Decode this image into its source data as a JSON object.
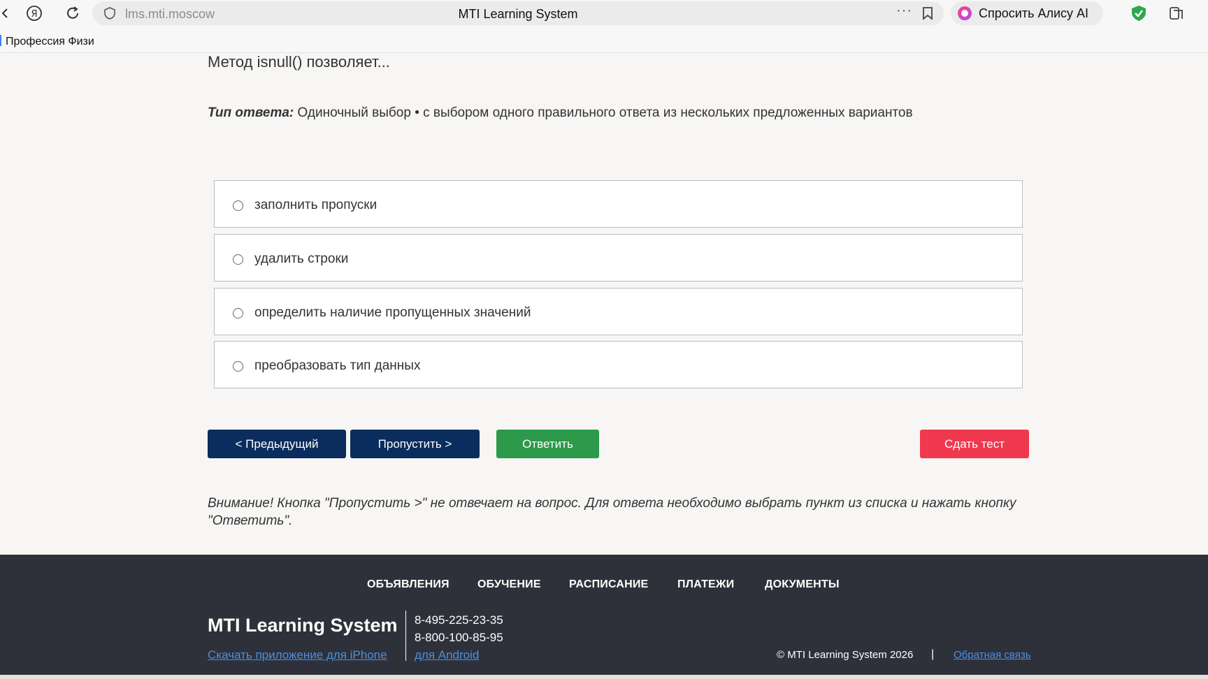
{
  "browser": {
    "url": "lms.mti.moscow",
    "tab_title": "MTI Learning System",
    "alice_label": "Спросить Алису AI",
    "bookmark_item": "Профессия Физи"
  },
  "question": {
    "text": "Метод isnull() позволяет...",
    "answer_type_label": "Тип ответа:",
    "answer_type_value": " Одиночный выбор • с выбором одного правильного ответа из нескольких предложенных вариантов"
  },
  "options": [
    {
      "label": "заполнить пропуски"
    },
    {
      "label": "удалить строки"
    },
    {
      "label": "определить наличие пропущенных значений"
    },
    {
      "label": "преобразовать тип данных"
    }
  ],
  "buttons": {
    "prev": "< Предыдущий",
    "skip": "Пропустить >",
    "answer": "Ответить",
    "submit": "Сдать тест"
  },
  "warning": "Внимание! Кнопка \"Пропустить >\" не отвечает на вопрос. Для ответа необходимо выбрать пункт из списка и нажать кнопку \"Ответить\".",
  "footer": {
    "nav": [
      "ОБЪЯВЛЕНИЯ",
      "ОБУЧЕНИЕ",
      "РАСПИСАНИЕ",
      "ПЛАТЕЖИ",
      "ДОКУМЕНТЫ"
    ],
    "brand": "MTI Learning System",
    "phones": [
      "8-495-225-23-35",
      "8-800-100-85-95"
    ],
    "iphone_link": "Скачать приложение для iPhone",
    "android_link": "для Android",
    "copyright": "© MTI Learning System 2026",
    "separator": "|",
    "feedback": "Обратная связь"
  },
  "colors": {
    "primary_button": "#0b2d5e",
    "answer_button": "#2c9a4a",
    "submit_button": "#f0384e",
    "footer_bg": "#2f313a",
    "link": "#4a90e2"
  }
}
